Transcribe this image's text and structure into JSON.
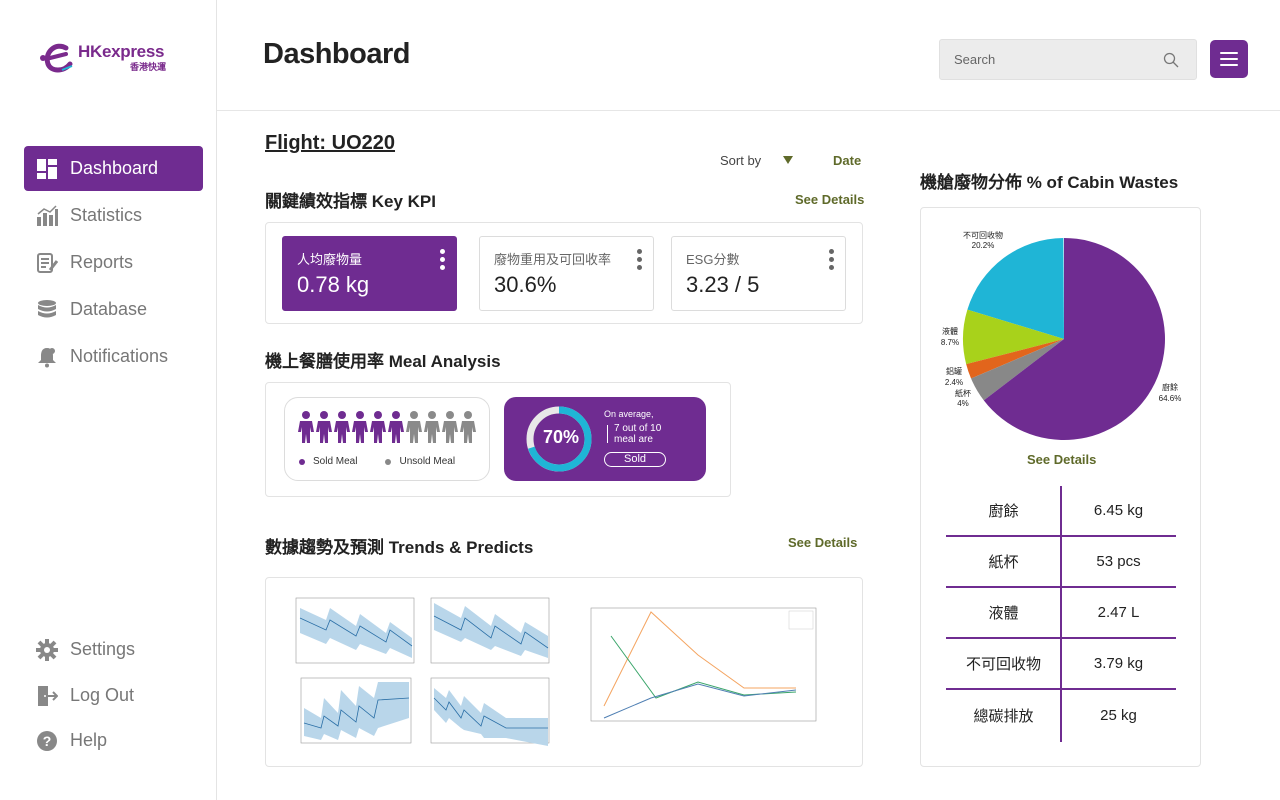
{
  "brand": {
    "logo_text": "HKexpress",
    "logo_sub": "香港快運",
    "color": "#6f2c91"
  },
  "sidebar": {
    "items": [
      {
        "label": "Dashboard",
        "icon": "dashboard-icon",
        "active": true
      },
      {
        "label": "Statistics",
        "icon": "bar-chart-icon"
      },
      {
        "label": "Reports",
        "icon": "report-icon"
      },
      {
        "label": "Database",
        "icon": "database-icon"
      },
      {
        "label": "Notifications",
        "icon": "bell-icon"
      }
    ],
    "bottom": [
      {
        "label": "Settings",
        "icon": "gear-icon"
      },
      {
        "label": "Log Out",
        "icon": "logout-icon"
      },
      {
        "label": "Help",
        "icon": "help-icon"
      }
    ]
  },
  "header": {
    "title": "Dashboard",
    "search_placeholder": "Search"
  },
  "flight": {
    "label": "Flight: UO220"
  },
  "sort": {
    "label": "Sort by",
    "value": "Date"
  },
  "kpi": {
    "title": "關鍵績效指標 Key KPI",
    "see_details": "See Details",
    "cards": [
      {
        "label": "人均廢物量",
        "value": "0.78 kg"
      },
      {
        "label": "廢物重用及可回收率",
        "value": "30.6%"
      },
      {
        "label": "ESG分數",
        "value": "3.23 / 5"
      }
    ]
  },
  "meal": {
    "title": "機上餐膳使用率 Meal Analysis",
    "sold_count": 6,
    "unsold_count": 4,
    "legend_sold": "Sold Meal",
    "legend_unsold": "Unsold Meal",
    "percent_label": "70%",
    "percent": 70,
    "on_average": "On average,",
    "out_of": "7 out of 10 meal are",
    "sold_pill": "Sold"
  },
  "trends": {
    "title": "數據趨勢及預測 Trends & Predicts",
    "see_details": "See Details"
  },
  "cabin": {
    "title": "機艙廢物分佈 % of Cabin Wastes",
    "see_details": "See Details",
    "slices": [
      {
        "name": "廚餘",
        "pct": "64.6%",
        "value": 64.6,
        "color": "#6f2c91"
      },
      {
        "name": "紙杯",
        "pct": "4%",
        "value": 4.0,
        "color": "#888888"
      },
      {
        "name": "鋁罐",
        "pct": "2.4%",
        "value": 2.4,
        "color": "#e2651c"
      },
      {
        "name": "液體",
        "pct": "8.7%",
        "value": 8.7,
        "color": "#a8d21b"
      },
      {
        "name": "不可回收物",
        "pct": "20.2%",
        "value": 20.2,
        "color": "#1fb5d6"
      }
    ],
    "table": [
      {
        "name": "廚餘",
        "value": "6.45 kg"
      },
      {
        "name": "紙杯",
        "value": "53 pcs"
      },
      {
        "name": "液體",
        "value": "2.47 L"
      },
      {
        "name": "不可回收物",
        "value": "3.79 kg"
      },
      {
        "name": "總碳排放",
        "value": "25 kg"
      }
    ]
  }
}
